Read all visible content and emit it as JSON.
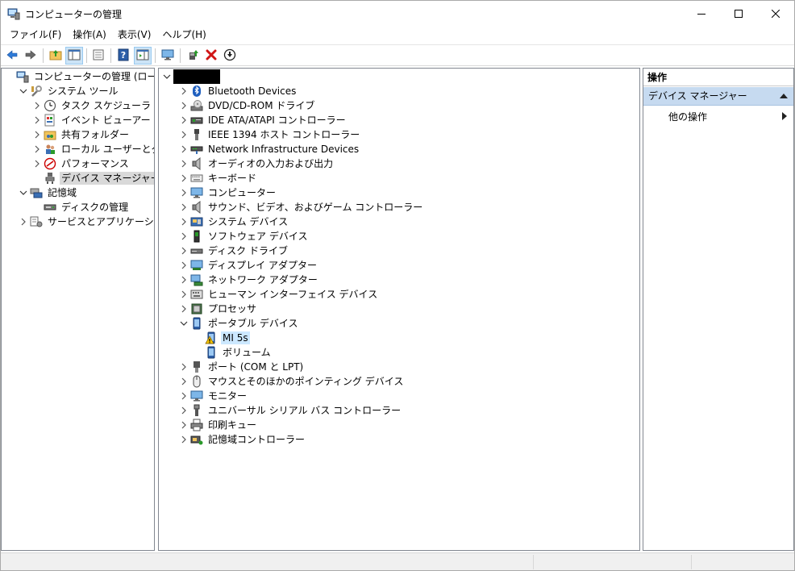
{
  "window": {
    "title": "コンピューターの管理"
  },
  "menubar": [
    "ファイル(F)",
    "操作(A)",
    "表示(V)",
    "ヘルプ(H)"
  ],
  "left_tree": [
    {
      "label": "コンピューターの管理 (ローカル)",
      "icon": "computer-management-icon",
      "level": 0,
      "expander": "none"
    },
    {
      "label": "システム ツール",
      "icon": "system-tools-icon",
      "level": 1,
      "expander": "expanded"
    },
    {
      "label": "タスク スケジューラ",
      "icon": "clock-icon",
      "level": 2,
      "expander": "collapsed"
    },
    {
      "label": "イベント ビューアー",
      "icon": "event-viewer-icon",
      "level": 2,
      "expander": "collapsed"
    },
    {
      "label": "共有フォルダー",
      "icon": "shared-folder-icon",
      "level": 2,
      "expander": "collapsed"
    },
    {
      "label": "ローカル ユーザーとグループ",
      "icon": "users-icon",
      "level": 2,
      "expander": "collapsed"
    },
    {
      "label": "パフォーマンス",
      "icon": "performance-icon",
      "level": 2,
      "expander": "collapsed"
    },
    {
      "label": "デバイス マネージャー",
      "icon": "device-manager-icon",
      "level": 2,
      "expander": "none",
      "selected": true
    },
    {
      "label": "記憶域",
      "icon": "storage-icon",
      "level": 1,
      "expander": "expanded"
    },
    {
      "label": "ディスクの管理",
      "icon": "disk-management-icon",
      "level": 2,
      "expander": "none"
    },
    {
      "label": "サービスとアプリケーション",
      "icon": "services-icon",
      "level": 1,
      "expander": "collapsed"
    }
  ],
  "device_tree": [
    {
      "label": "Bluetooth Devices",
      "icon": "bluetooth-icon",
      "level": 1,
      "expander": "collapsed"
    },
    {
      "label": "DVD/CD-ROM ドライブ",
      "icon": "dvd-drive-icon",
      "level": 1,
      "expander": "collapsed"
    },
    {
      "label": "IDE ATA/ATAPI コントローラー",
      "icon": "ide-controller-icon",
      "level": 1,
      "expander": "collapsed"
    },
    {
      "label": "IEEE 1394 ホスト コントローラー",
      "icon": "ieee1394-icon",
      "level": 1,
      "expander": "collapsed"
    },
    {
      "label": "Network Infrastructure Devices",
      "icon": "network-infrastructure-icon",
      "level": 1,
      "expander": "collapsed"
    },
    {
      "label": "オーディオの入力および出力",
      "icon": "speaker-icon",
      "level": 1,
      "expander": "collapsed"
    },
    {
      "label": "キーボード",
      "icon": "keyboard-icon",
      "level": 1,
      "expander": "collapsed"
    },
    {
      "label": "コンピューター",
      "icon": "monitor-icon",
      "level": 1,
      "expander": "collapsed"
    },
    {
      "label": "サウンド、ビデオ、およびゲーム コントローラー",
      "icon": "speaker-icon",
      "level": 1,
      "expander": "collapsed"
    },
    {
      "label": "システム デバイス",
      "icon": "system-devices-icon",
      "level": 1,
      "expander": "collapsed"
    },
    {
      "label": "ソフトウェア デバイス",
      "icon": "software-device-icon",
      "level": 1,
      "expander": "collapsed"
    },
    {
      "label": "ディスク ドライブ",
      "icon": "disk-drive-icon",
      "level": 1,
      "expander": "collapsed"
    },
    {
      "label": "ディスプレイ アダプター",
      "icon": "display-adapter-icon",
      "level": 1,
      "expander": "collapsed"
    },
    {
      "label": "ネットワーク アダプター",
      "icon": "network-adapter-icon",
      "level": 1,
      "expander": "collapsed"
    },
    {
      "label": "ヒューマン インターフェイス デバイス",
      "icon": "hid-icon",
      "level": 1,
      "expander": "collapsed"
    },
    {
      "label": "プロセッサ",
      "icon": "processor-icon",
      "level": 1,
      "expander": "collapsed"
    },
    {
      "label": "ポータブル デバイス",
      "icon": "portable-device-icon",
      "level": 1,
      "expander": "expanded"
    },
    {
      "label": "MI 5s",
      "icon": "warning-icon",
      "level": 2,
      "expander": "none",
      "highlight": true
    },
    {
      "label": "ボリューム",
      "icon": "portable-device-icon",
      "level": 2,
      "expander": "none"
    },
    {
      "label": "ポート (COM と LPT)",
      "icon": "port-icon",
      "level": 1,
      "expander": "collapsed"
    },
    {
      "label": "マウスとそのほかのポインティング デバイス",
      "icon": "mouse-icon",
      "level": 1,
      "expander": "collapsed"
    },
    {
      "label": "モニター",
      "icon": "monitor-icon",
      "level": 1,
      "expander": "collapsed"
    },
    {
      "label": "ユニバーサル シリアル バス コントローラー",
      "icon": "usb-icon",
      "level": 1,
      "expander": "collapsed"
    },
    {
      "label": "印刷キュー",
      "icon": "printer-icon",
      "level": 1,
      "expander": "collapsed"
    },
    {
      "label": "記憶域コントローラー",
      "icon": "storage-controller-icon",
      "level": 1,
      "expander": "collapsed"
    }
  ],
  "actions": {
    "header": "操作",
    "section": "デバイス マネージャー",
    "item": "他の操作"
  }
}
